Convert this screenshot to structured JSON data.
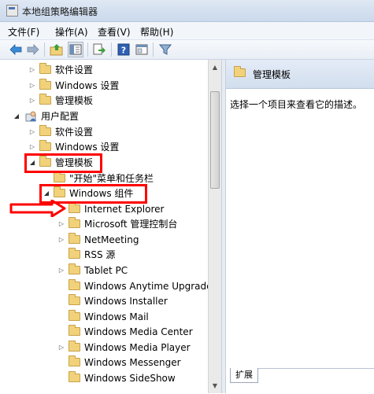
{
  "window": {
    "title": "本地组策略编辑器"
  },
  "menu": [
    "文件(F)",
    "操作(A)",
    "查看(V)",
    "帮助(H)"
  ],
  "toolbar": {
    "icons": [
      "back-icon",
      "forward-icon",
      "up-folder-icon",
      "show-hide-tree-icon",
      "export-list-icon",
      "help-icon",
      "properties-view-icon",
      "filter-icon"
    ]
  },
  "tree": [
    {
      "label": "软件设置",
      "indent": 1,
      "expander": "collapsed"
    },
    {
      "label": "Windows 设置",
      "indent": 1,
      "expander": "collapsed"
    },
    {
      "label": "管理模板",
      "indent": 1,
      "expander": "collapsed"
    },
    {
      "label": "用户配置",
      "indent": 0,
      "expander": "expanded",
      "icon": "user"
    },
    {
      "label": "软件设置",
      "indent": 1,
      "expander": "collapsed"
    },
    {
      "label": "Windows 设置",
      "indent": 1,
      "expander": "collapsed"
    },
    {
      "label": "管理模板",
      "indent": 1,
      "expander": "expanded"
    },
    {
      "label": "\"开始\"菜单和任务栏",
      "indent": 2,
      "expander": "none"
    },
    {
      "label": "Windows 组件",
      "indent": 2,
      "expander": "expanded"
    },
    {
      "label": "Internet Explorer",
      "indent": 3,
      "expander": "none"
    },
    {
      "label": "Microsoft 管理控制台",
      "indent": 3,
      "expander": "collapsed"
    },
    {
      "label": "NetMeeting",
      "indent": 3,
      "expander": "collapsed"
    },
    {
      "label": "RSS 源",
      "indent": 3,
      "expander": "none"
    },
    {
      "label": "Tablet PC",
      "indent": 3,
      "expander": "collapsed"
    },
    {
      "label": "Windows Anytime Upgrade",
      "indent": 3,
      "expander": "none"
    },
    {
      "label": "Windows Installer",
      "indent": 3,
      "expander": "none"
    },
    {
      "label": "Windows Mail",
      "indent": 3,
      "expander": "none"
    },
    {
      "label": "Windows Media Center",
      "indent": 3,
      "expander": "none"
    },
    {
      "label": "Windows Media Player",
      "indent": 3,
      "expander": "collapsed"
    },
    {
      "label": "Windows Messenger",
      "indent": 3,
      "expander": "none"
    },
    {
      "label": "Windows SideShow",
      "indent": 3,
      "expander": "none"
    }
  ],
  "right_pane": {
    "header_title": "管理模板",
    "description": "选择一个项目来查看它的描述。",
    "tab_label": "扩展"
  },
  "annotations": {
    "color": "#ff0000"
  }
}
